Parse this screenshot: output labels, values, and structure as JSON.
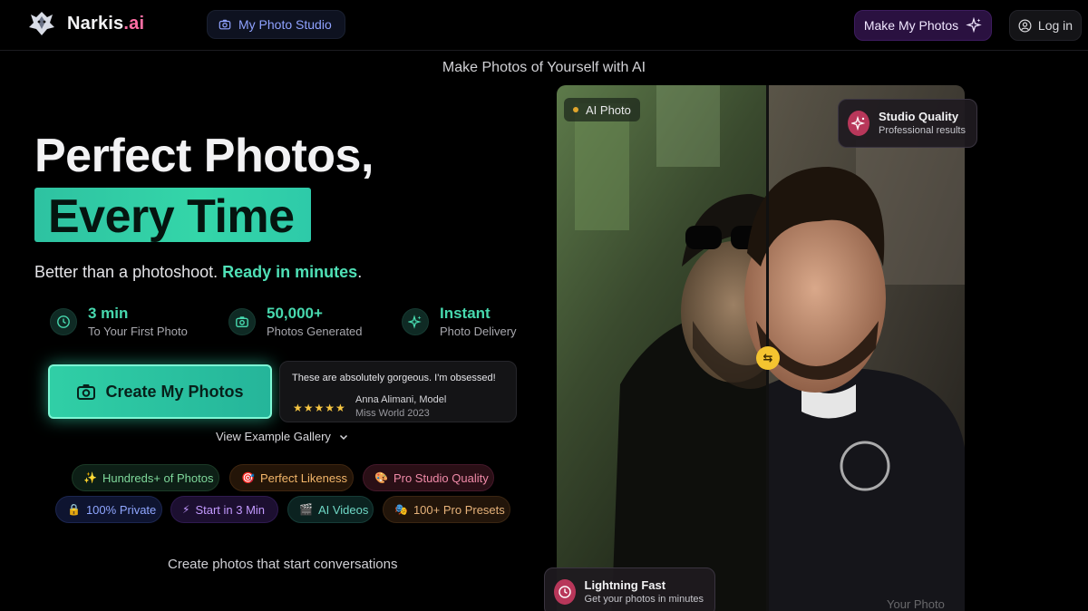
{
  "nav": {
    "brand_name": "Narkis",
    "brand_suffix": ".ai",
    "studio_link": "My Photo Studio",
    "make_button": "Make My Photos",
    "login_button": "Log in"
  },
  "tagline": "Make Photos of Yourself with AI",
  "hero": {
    "title_line1": "Perfect Photos,",
    "title_line2": "Every Time",
    "subtitle_plain": "Better than a photoshoot. ",
    "subtitle_highlight": "Ready in minutes",
    "subtitle_end": ".",
    "stats": [
      {
        "value": "3 min",
        "label": "To Your First Photo",
        "icon": "clock-icon"
      },
      {
        "value": "50,000+",
        "label": "Photos Generated",
        "icon": "camera-icon"
      },
      {
        "value": "Instant",
        "label": "Photo Delivery",
        "icon": "sparkle-icon"
      }
    ],
    "cta_label": "Create My Photos",
    "review": {
      "quote": "These are absolutely gorgeous. I'm obsessed!",
      "stars": "★★★★★",
      "name": "Anna Alimani, Model",
      "title": "Miss World 2023"
    },
    "gallery_link": "View Example Gallery",
    "features": [
      {
        "icon": "✨",
        "label": "Hundreds+ of Photos"
      },
      {
        "icon": "🎯",
        "label": "Perfect Likeness"
      },
      {
        "icon": "🎨",
        "label": "Pro Studio Quality"
      },
      {
        "icon": "🔒",
        "label": "100% Private"
      },
      {
        "icon": "⚡",
        "label": "Start in 3 Min"
      },
      {
        "icon": "🎬",
        "label": "AI Videos"
      },
      {
        "icon": "🎭",
        "label": "100+ Pro Presets"
      }
    ],
    "bottom_text": "Create photos that start conversations"
  },
  "comparison": {
    "left_badge": "AI Photo",
    "right_label": "Your Photo",
    "handle_icon": "⇆",
    "card_top": {
      "title": "Studio Quality",
      "subtitle": "Professional results"
    },
    "card_bottom": {
      "title": "Lightning Fast",
      "subtitle": "Get your photos in minutes"
    }
  },
  "colors": {
    "accent_teal": "#34d6a9",
    "accent_pink": "#ff6fa5",
    "accent_purple": "#2a1140",
    "handle_yellow": "#f4c430"
  }
}
